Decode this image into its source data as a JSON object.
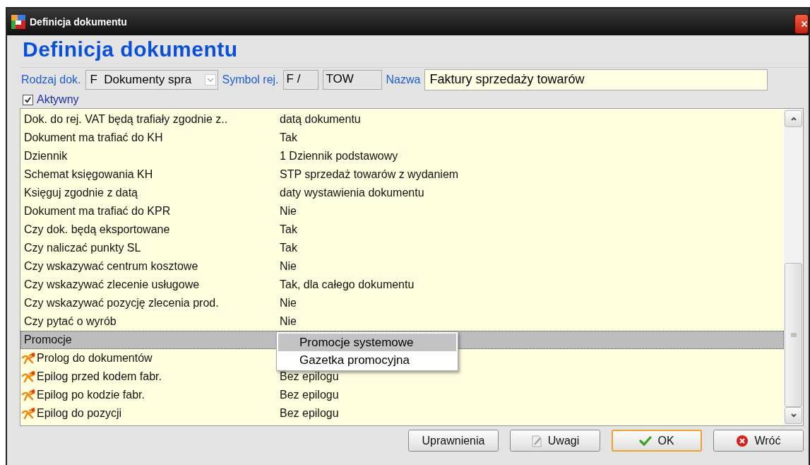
{
  "window": {
    "title": "Definicja dokumentu"
  },
  "heading": "Definicja dokumentu",
  "form": {
    "doc_type_label": "Rodzaj dok.",
    "doc_type_value": "F  Dokumenty spra",
    "symbol_label": "Symbol rej.",
    "symbol_prefix": "F /",
    "symbol_value": "TOW",
    "name_label": "Nazwa",
    "name_value": "Faktury sprzedaży towarów"
  },
  "active": {
    "label": "Aktywny",
    "checked": true
  },
  "rows": [
    {
      "kind": "plain",
      "label": "Dok. do rej. VAT będą trafiały zgodnie z..",
      "value": "datą dokumentu",
      "selected": false
    },
    {
      "kind": "plain",
      "label": "Dokument ma trafiać do KH",
      "value": "Tak",
      "selected": false
    },
    {
      "kind": "plain",
      "label": "Dziennik",
      "value": "1 Dziennik podstawowy",
      "selected": false
    },
    {
      "kind": "plain",
      "label": "Schemat księgowania KH",
      "value": "STP sprzedaż towarów z wydaniem",
      "selected": false
    },
    {
      "kind": "plain",
      "label": "Księguj zgodnie z datą",
      "value": "daty wystawienia dokumentu",
      "selected": false
    },
    {
      "kind": "plain",
      "label": "Dokument ma trafiać do KPR",
      "value": "Nie",
      "selected": false
    },
    {
      "kind": "plain",
      "label": "Czy dok. będą eksportowane",
      "value": "Tak",
      "selected": false
    },
    {
      "kind": "plain",
      "label": "Czy naliczać punkty SL",
      "value": "Tak",
      "selected": false
    },
    {
      "kind": "plain",
      "label": "Czy wskazywać centrum kosztowe",
      "value": "Nie",
      "selected": false
    },
    {
      "kind": "plain",
      "label": "Czy wskazywać zlecenie usługowe",
      "value": "Tak, dla całego dokumentu",
      "selected": false
    },
    {
      "kind": "plain",
      "label": "Czy wskazywać pozycję zlecenia prod.",
      "value": "Nie",
      "selected": false
    },
    {
      "kind": "plain",
      "label": "Czy pytać o wyrób",
      "value": "Nie",
      "selected": false
    },
    {
      "kind": "plain",
      "label": "Promocje",
      "selected": true
    },
    {
      "kind": "script",
      "label": "Prolog do dokumentów",
      "selected": false
    },
    {
      "kind": "script",
      "label": "Epilog przed kodem fabr.",
      "value": "Bez epilogu",
      "selected": false
    },
    {
      "kind": "script",
      "label": "Epilog po kodzie fabr.",
      "value": "Bez epilogu",
      "selected": false
    },
    {
      "kind": "script",
      "label": "Epilog do pozycji",
      "value": "Bez epilogu",
      "selected": false
    }
  ],
  "popup": {
    "items": [
      {
        "label": "Promocje systemowe",
        "selected": true
      },
      {
        "label": "Gazetka promocyjna",
        "selected": false
      }
    ]
  },
  "buttons": [
    {
      "kind": "plain",
      "label": "Uprawnienia",
      "default": false
    },
    {
      "kind": "notes",
      "label": "Uwagi",
      "default": false
    },
    {
      "kind": "ok",
      "label": "OK",
      "default": true
    },
    {
      "kind": "back",
      "label": "Wróć",
      "default": false
    }
  ]
}
